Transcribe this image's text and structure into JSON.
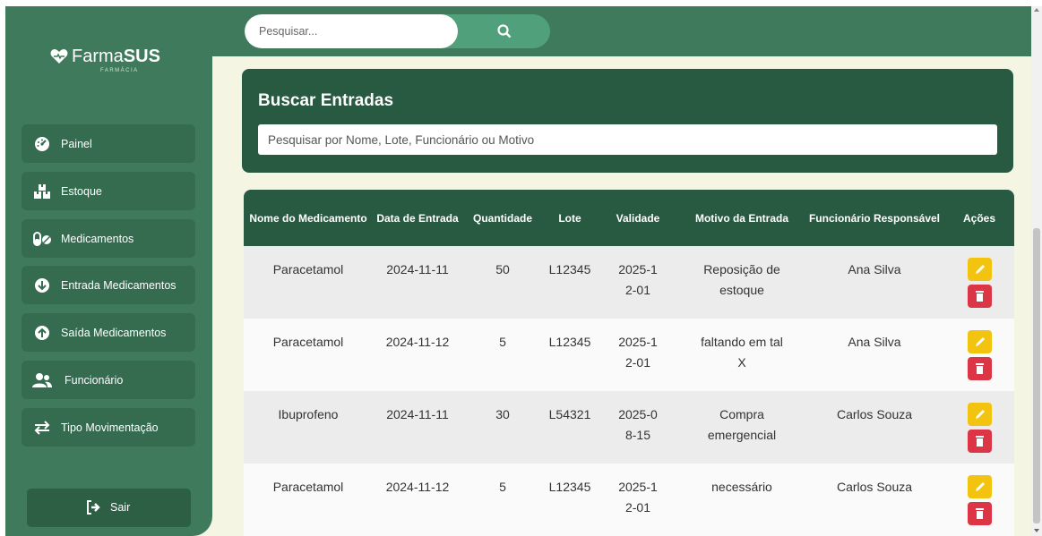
{
  "brand": {
    "name_light": "Farma",
    "name_bold": "SUS",
    "subtitle": "FARMÁCIA"
  },
  "topbar": {
    "search_placeholder": "Pesquisar..."
  },
  "sidebar": {
    "items": [
      {
        "label": "Painel",
        "icon": "dashboard-icon"
      },
      {
        "label": "Estoque",
        "icon": "boxes-icon"
      },
      {
        "label": "Medicamentos",
        "icon": "pills-icon"
      },
      {
        "label": "Entrada Medicamentos",
        "icon": "arrow-down-circle-icon"
      },
      {
        "label": "Saída Medicamentos",
        "icon": "arrow-up-circle-icon"
      },
      {
        "label": "Funcionário",
        "icon": "users-icon"
      },
      {
        "label": "Tipo Movimentação",
        "icon": "exchange-icon"
      }
    ],
    "logout_label": "Sair"
  },
  "search_panel": {
    "title": "Buscar Entradas",
    "placeholder": "Pesquisar por Nome, Lote, Funcionário ou Motivo"
  },
  "table": {
    "headers": [
      "Nome do Medicamento",
      "Data de Entrada",
      "Quantidade",
      "Lote",
      "Validade",
      "Motivo da Entrada",
      "Funcionário Responsável",
      "Ações"
    ],
    "rows": [
      [
        "Paracetamol",
        "2024-11-11",
        "50",
        "L12345",
        "2025-12-01",
        "Reposição de estoque",
        "Ana Silva"
      ],
      [
        "Paracetamol",
        "2024-11-12",
        "5",
        "L12345",
        "2025-12-01",
        "faltando em tal X",
        "Ana Silva"
      ],
      [
        "Ibuprofeno",
        "2024-11-11",
        "30",
        "L54321",
        "2025-08-15",
        "Compra emergencial",
        "Carlos Souza"
      ],
      [
        "Paracetamol",
        "2024-11-12",
        "5",
        "L12345",
        "2025-12-01",
        "necessário",
        "Carlos Souza"
      ]
    ]
  },
  "colors": {
    "sidebar": "#3f7a5c",
    "panel": "#285a41",
    "accent": "#4fa07b",
    "edit": "#f2c40f",
    "delete": "#dc3545",
    "background": "#f5f5e4"
  }
}
